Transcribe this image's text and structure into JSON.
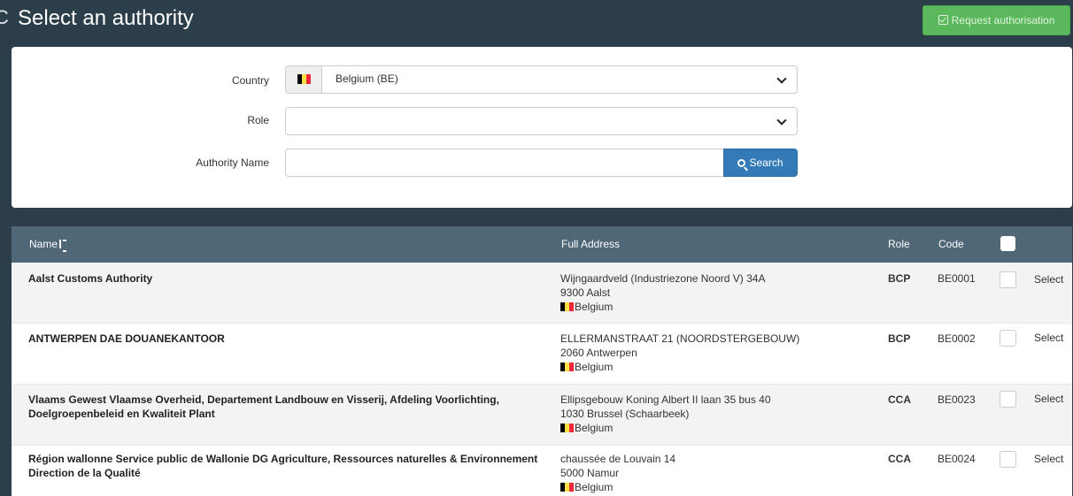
{
  "header": {
    "title": "Select an authority",
    "request_label": "Request authorisation"
  },
  "form": {
    "country_label": "Country",
    "country_value": "Belgium (BE)",
    "role_label": "Role",
    "role_value": "",
    "authority_label": "Authority Name",
    "authority_value": "",
    "search_label": "Search"
  },
  "table": {
    "columns": {
      "name": "Name",
      "address": "Full Address",
      "role": "Role",
      "code": "Code"
    },
    "select_label": "Select",
    "rows": [
      {
        "name": "Aalst Customs Authority",
        "address1": "Wijngaardveld (Industriezone Noord V) 34A",
        "address2": "9300 Aalst",
        "country": "Belgium",
        "role": "BCP",
        "code": "BE0001"
      },
      {
        "name": "ANTWERPEN DAE DOUANEKANTOOR",
        "address1": "ELLERMANSTRAAT 21 (NOORDSTERGEBOUW)",
        "address2": "2060 Antwerpen",
        "country": "Belgium",
        "role": "BCP",
        "code": "BE0002"
      },
      {
        "name": "Vlaams Gewest Vlaamse Overheid, Departement Landbouw en Visserij, Afdeling Voorlichting, Doelgroepenbeleid en Kwaliteit Plant",
        "address1": "Ellipsgebouw Koning Albert II laan 35 bus 40",
        "address2": "1030 Brussel (Schaarbeek)",
        "country": "Belgium",
        "role": "CCA",
        "code": "BE0023"
      },
      {
        "name": "Région wallonne Service public de Wallonie DG Agriculture, Ressources naturelles & Environnement Direction de la Qualité",
        "address1": "chaussée de Louvain 14",
        "address2": "5000 Namur",
        "country": "Belgium",
        "role": "CCA",
        "code": "BE0024"
      }
    ]
  },
  "colors": {
    "header_bg": "#2b3e4a",
    "table_header_bg": "#4f6777",
    "primary_button": "#337ab7",
    "success_button": "#5cb85c"
  },
  "icons": [
    "back-chevron-icon",
    "check-square-icon",
    "belgium-flag-icon",
    "chevron-down-icon",
    "search-icon",
    "sort-alpha-icon",
    "checkbox-icon"
  ]
}
